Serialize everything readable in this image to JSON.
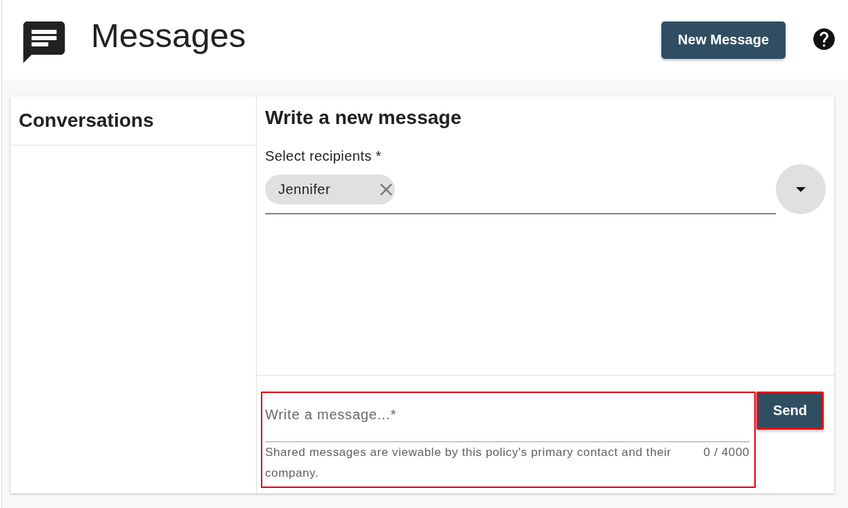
{
  "header": {
    "title": "Messages",
    "new_message_button": "New Message"
  },
  "conversations": {
    "title": "Conversations"
  },
  "compose": {
    "title": "Write a new message",
    "recipients": {
      "label": "Select recipients *",
      "chips": [
        {
          "label": "Jennifer"
        }
      ]
    },
    "message": {
      "placeholder": "Write a message...*",
      "helper": "Shared messages are viewable by this policy's primary contact and their company.",
      "counter": "0 / 4000",
      "highlighted": true
    },
    "send_button": {
      "label": "Send",
      "highlighted": true
    }
  }
}
